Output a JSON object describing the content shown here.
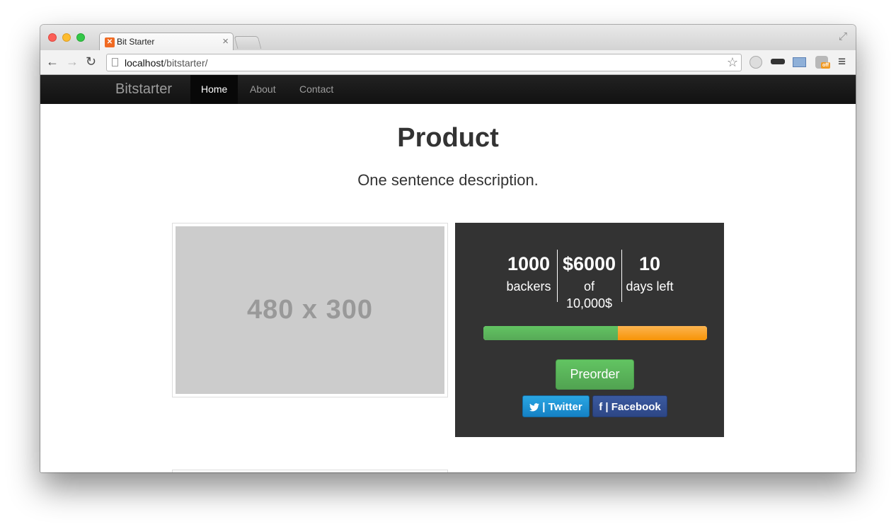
{
  "browser": {
    "tab_title": "Bit Starter",
    "tab_favicon": "xampp-icon",
    "url_host": "localhost",
    "url_path": "/bitstarter/",
    "close_glyph": "×"
  },
  "site": {
    "brand": "Bitstarter",
    "nav": [
      {
        "label": "Home",
        "active": true
      },
      {
        "label": "About",
        "active": false
      },
      {
        "label": "Contact",
        "active": false
      }
    ]
  },
  "product": {
    "title": "Product",
    "description": "One sentence description.",
    "image_placeholder": "480 x 300"
  },
  "funding": {
    "backers_value": "1000",
    "backers_label": "backers",
    "pledged_value": "$6000",
    "pledged_label": "of 10,000$",
    "days_value": "10",
    "days_label": "days left",
    "progress_fraction": 0.6,
    "progress_colors": {
      "funded": "#5cb85c",
      "remaining": "#f89406"
    }
  },
  "actions": {
    "preorder_label": "Preorder",
    "twitter_label": "| Twitter",
    "facebook_label": "| Facebook"
  }
}
